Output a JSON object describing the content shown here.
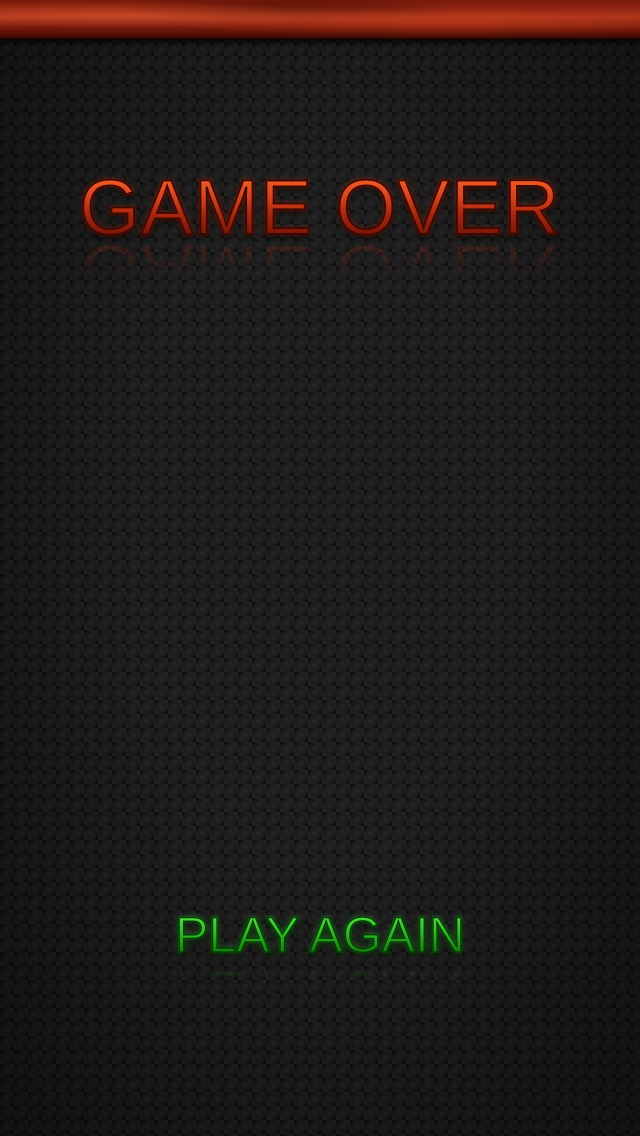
{
  "screen": {
    "title": "GAME OVER",
    "play_again_label": "PLAY AGAIN"
  },
  "colors": {
    "title_primary": "#e0461a",
    "button_primary": "#2ec21e",
    "top_bar": "#a8321a",
    "background": "#1d1d1d"
  }
}
